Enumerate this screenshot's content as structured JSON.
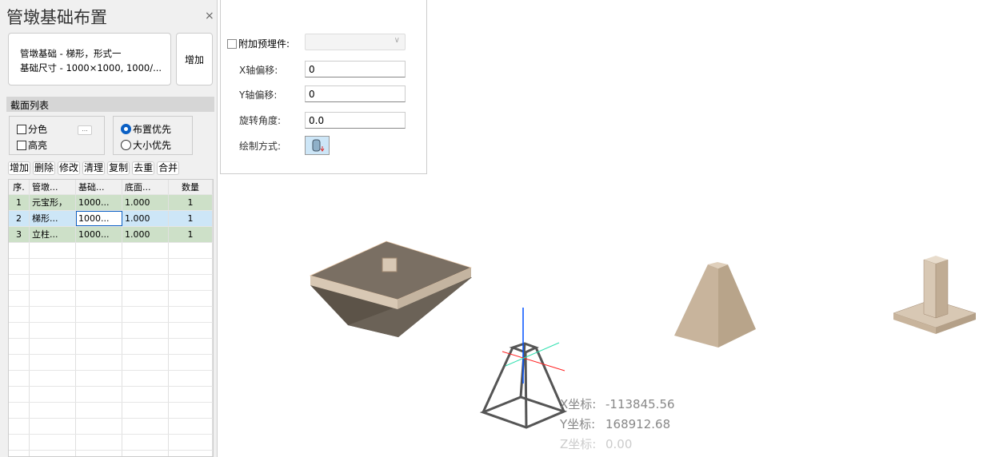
{
  "panel": {
    "title": "管墩基础布置",
    "close": "×",
    "desc_line1": "管墩基础 - 梯形，形式一",
    "desc_line2": "基础尺寸 - 1000×1000, 1000/...",
    "add_top": "增加",
    "section": "截面列表",
    "color_split": "分色",
    "highlight": "高亮",
    "more": "...",
    "layout_first": "布置优先",
    "size_first": "大小优先"
  },
  "tools": [
    "增加",
    "删除",
    "修改",
    "清理",
    "复制",
    "去重",
    "合并"
  ],
  "table": {
    "headers": [
      "序.",
      "管墩...",
      "基础...",
      "底面...",
      "数量"
    ],
    "rows": [
      [
        "1",
        "元宝形，",
        "1000...",
        "1.000",
        "1"
      ],
      [
        "2",
        "梯形...",
        "1000...",
        "1.000",
        "1"
      ],
      [
        "3",
        "立柱...",
        "1000...",
        "1.000",
        "1"
      ]
    ]
  },
  "props": {
    "embed_label": "附加预埋件:",
    "x_label": "X轴偏移:",
    "x_value": "0",
    "y_label": "Y轴偏移:",
    "y_value": "0",
    "rot_label": "旋转角度:",
    "rot_value": "0.0",
    "draw_label": "绘制方式:"
  },
  "coords": {
    "x_label": "X坐标:",
    "x_value": "-113845.56",
    "y_label": "Y坐标:",
    "y_value": "168912.68",
    "z_label": "Z坐标:",
    "z_value": "0.00"
  }
}
